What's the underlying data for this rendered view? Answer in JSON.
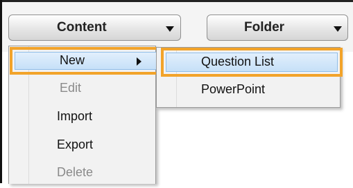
{
  "toolbar": {
    "content_dropdown": "Content",
    "folder_dropdown": "Folder"
  },
  "content_menu": {
    "items": [
      {
        "label": "New",
        "enabled": true,
        "highlighted": true,
        "has_submenu": true
      },
      {
        "label": "Edit",
        "enabled": false
      },
      {
        "label": "Import",
        "enabled": true
      },
      {
        "label": "Export",
        "enabled": true
      },
      {
        "label": "Delete",
        "enabled": false
      }
    ]
  },
  "new_submenu": {
    "items": [
      {
        "label": "Question List",
        "highlighted": true
      },
      {
        "label": "PowerPoint"
      }
    ]
  },
  "colors": {
    "highlight_border": "#f2a32a",
    "selection_fill": "#c6e0f8"
  },
  "icons": {
    "dropdown_arrow": "chevron-down-icon",
    "submenu_arrow": "chevron-right-icon"
  }
}
